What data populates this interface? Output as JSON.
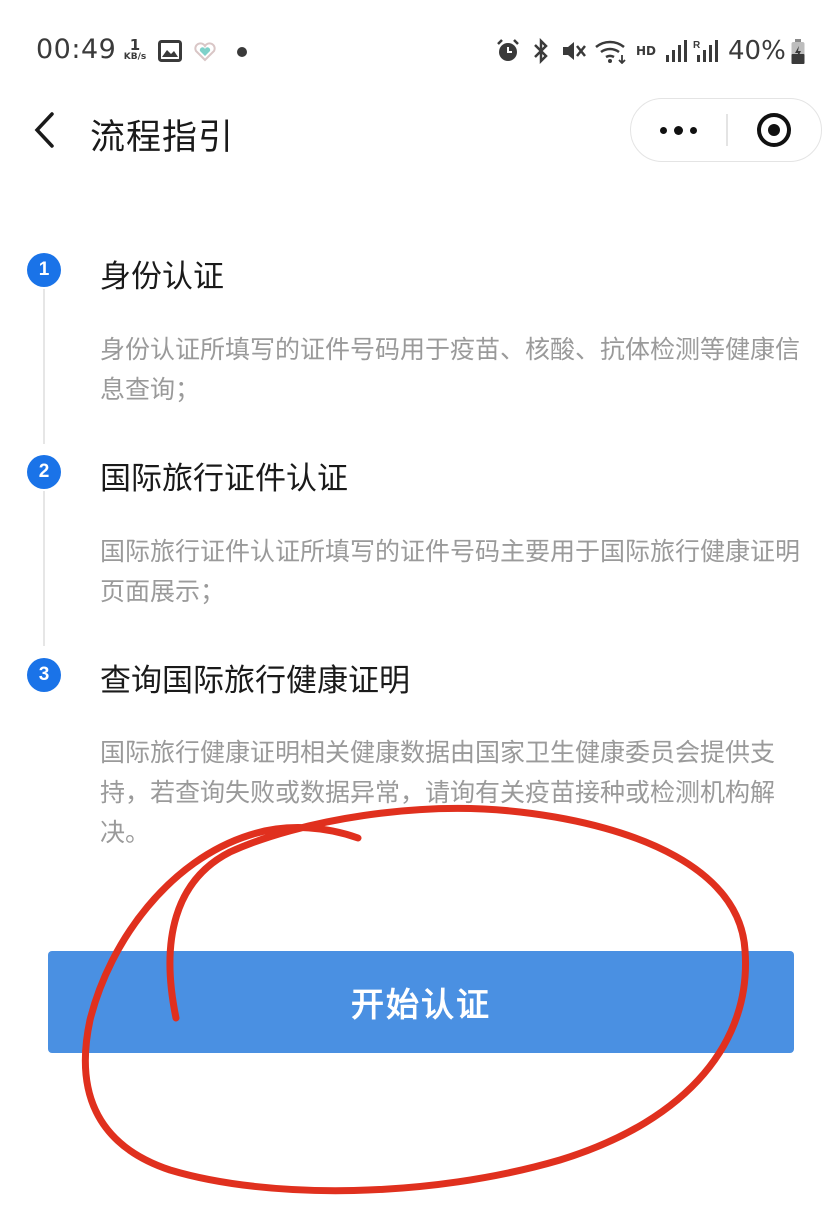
{
  "status_bar": {
    "time": "00:49",
    "net_speed_value": "1",
    "net_speed_unit": "KB/s",
    "network_label": "HD",
    "battery": "40%",
    "icons": [
      "gallery-icon",
      "heart-icon",
      "alarm-icon",
      "bluetooth-icon",
      "mute-icon",
      "wifi-icon",
      "signal-icon",
      "signal-roaming-icon",
      "battery-charging-icon"
    ]
  },
  "nav": {
    "title": "流程指引",
    "back_icon": "chevron-left-icon",
    "more_icon": "more-dots-icon",
    "close_icon": "miniprogram-close-icon"
  },
  "steps": [
    {
      "number": "1",
      "title": "身份认证",
      "desc": "身份认证所填写的证件号码用于疫苗、核酸、抗体检测等健康信息查询；"
    },
    {
      "number": "2",
      "title": "国际旅行证件认证",
      "desc": "国际旅行证件认证所填写的证件号码主要用于国际旅行健康证明页面展示；"
    },
    {
      "number": "3",
      "title": "查询国际旅行健康证明",
      "desc": "国际旅行健康证明相关健康数据由国家卫生健康委员会提供支持，若查询失败或数据异常，请询有关疫苗接种或检测机构解决。"
    }
  ],
  "primary_button": {
    "label": "开始认证"
  },
  "colors": {
    "accent": "#1a73e8",
    "button": "#4a90e2",
    "desc_text": "#9a9a9a",
    "annotation": "#e0301e"
  }
}
